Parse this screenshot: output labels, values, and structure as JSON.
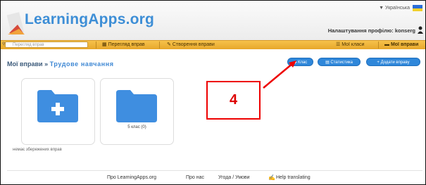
{
  "header": {
    "logo_text": "LearningApps.org",
    "language": "▼ Українська",
    "profile_settings": "Налаштування профілю: konserg"
  },
  "nav": {
    "search_placeholder": "Перегляд вправ",
    "browse_label": "Перегляд вправ",
    "create_label": "Створення вправи",
    "classes_label": "Мої класи",
    "exercises_label": "Мої вправи"
  },
  "main": {
    "title_prefix": "Мої вправи",
    "title_separator": "»",
    "title_crumb": "Трудове навчання",
    "buttons": {
      "class": "Клас",
      "statistics": "Статистика",
      "add_exercise": "+ Додати вправу"
    },
    "folders": [
      {
        "label": ""
      },
      {
        "label": "5 клас (0)"
      }
    ],
    "empty_text": "немає збережених вправ"
  },
  "annotation": {
    "number": "4"
  },
  "footer": {
    "about": "Про LearningApps.org",
    "about_us": "Про нас",
    "terms": "Угода / Умови",
    "help_translating": "Help translating"
  },
  "colors": {
    "accent": "#3f88d4",
    "navbar": "#efb23a",
    "button": "#2f87da",
    "annotation": "#e00000"
  }
}
